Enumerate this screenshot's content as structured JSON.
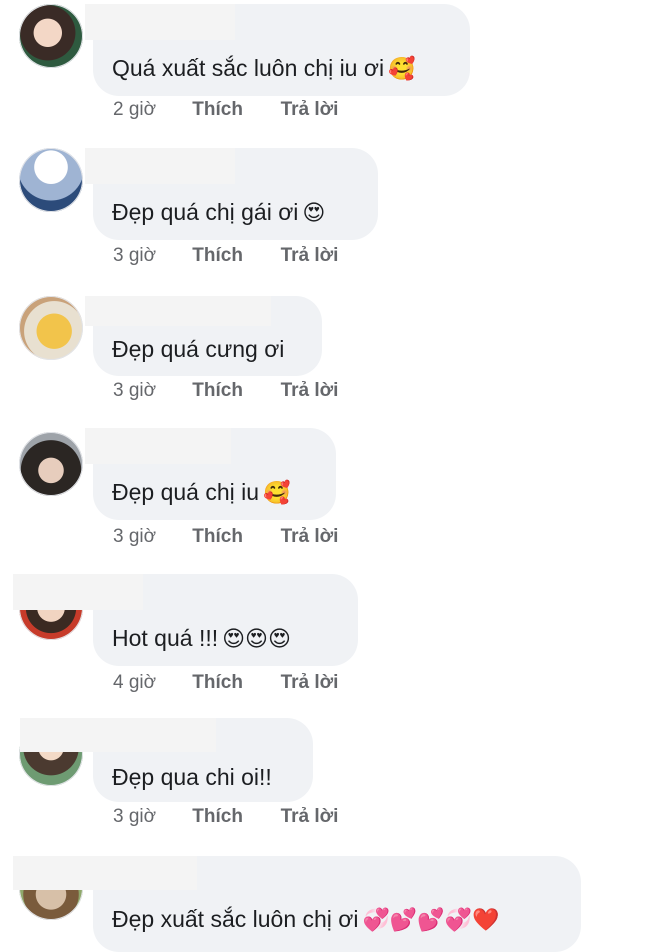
{
  "comments": [
    {
      "text": "Quá xuất sắc luôn chị iu ơi",
      "emoji": "🥰",
      "time": "2 giờ",
      "like": "Thích",
      "reply": "Trả lời"
    },
    {
      "text": "Đẹp quá chị gái ơi",
      "emoji": "😍",
      "time": "3 giờ",
      "like": "Thích",
      "reply": "Trả lời"
    },
    {
      "text": "Đẹp quá cưng ơi",
      "emoji": "",
      "time": "3 giờ",
      "like": "Thích",
      "reply": "Trả lời"
    },
    {
      "text": "Đẹp quá chị iu",
      "emoji": "🥰",
      "time": "3 giờ",
      "like": "Thích",
      "reply": "Trả lời"
    },
    {
      "text": "Hot quá !!!",
      "emoji": "😍😍😍",
      "time": "4 giờ",
      "like": "Thích",
      "reply": "Trả lời"
    },
    {
      "text": "Đẹp qua chi oi!!",
      "emoji": "",
      "time": "3 giờ",
      "like": "Thích",
      "reply": "Trả lời"
    },
    {
      "text": "Đẹp xuất sắc luôn chị ơi",
      "emoji": "💞💕💕💞❤️",
      "time": "",
      "like": "",
      "reply": ""
    }
  ],
  "colors": {
    "bubble": "#f0f2f5",
    "meta": "#65676b",
    "text": "#1c1e21"
  }
}
